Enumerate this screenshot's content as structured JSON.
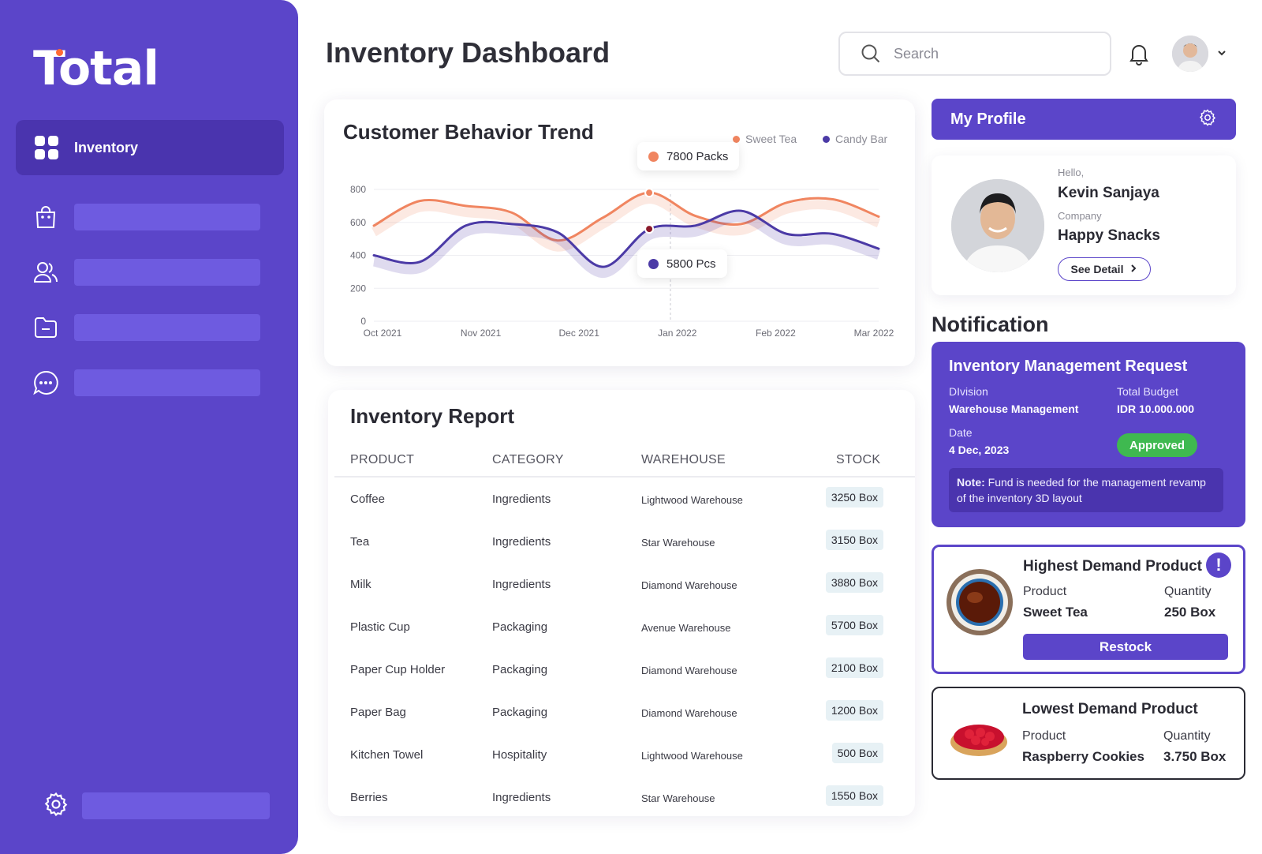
{
  "app": {
    "logo_text": "Total",
    "page_title": "Inventory Dashboard"
  },
  "colors": {
    "accent": "#5b45c9",
    "sweet_tea": "#f08560",
    "candy_bar": "#4b3aa6",
    "approved": "#3fb950"
  },
  "sidebar": {
    "active_item": {
      "label": "Inventory",
      "icon": "grid-icon"
    },
    "items": [
      {
        "icon": "shopping-bag-icon"
      },
      {
        "icon": "users-icon"
      },
      {
        "icon": "folder-icon"
      },
      {
        "icon": "chat-icon"
      }
    ],
    "settings_icon": "gear-icon"
  },
  "header": {
    "search_placeholder": "Search",
    "bell_icon": "bell-icon"
  },
  "chart_data": {
    "type": "line",
    "title": "Customer Behavior Trend",
    "x": [
      "Oct 2021",
      "Nov 2021",
      "Dec 2021",
      "Jan 2022",
      "Feb 2022",
      "Mar 2022"
    ],
    "y_ticks": [
      "800",
      "600",
      "400",
      "200",
      "0"
    ],
    "ylim": [
      0,
      800
    ],
    "grid": true,
    "legend_position": "top-right",
    "series": [
      {
        "name": "Sweet Tea",
        "color": "#f08560",
        "values": [
          580,
          730,
          700,
          660,
          490,
          630,
          780,
          640,
          590,
          720,
          740,
          635
        ]
      },
      {
        "name": "Candy Bar",
        "color": "#4b3aa6",
        "values": [
          400,
          360,
          580,
          590,
          540,
          330,
          560,
          580,
          670,
          530,
          530,
          440
        ]
      }
    ],
    "tooltips": [
      {
        "text": "7800 Packs",
        "series": "Sweet Tea"
      },
      {
        "text": "5800 Pcs",
        "series": "Candy Bar"
      }
    ]
  },
  "report": {
    "title": "Inventory Report",
    "columns": [
      "PRODUCT",
      "CATEGORY",
      "WAREHOUSE",
      "STOCK"
    ],
    "rows": [
      {
        "product": "Coffee",
        "category": "Ingredients",
        "warehouse": "Lightwood Warehouse",
        "stock": "3250 Box"
      },
      {
        "product": "Tea",
        "category": "Ingredients",
        "warehouse": "Star Warehouse",
        "stock": "3150 Box"
      },
      {
        "product": "Milk",
        "category": "Ingredients",
        "warehouse": "Diamond Warehouse",
        "stock": "3880 Box"
      },
      {
        "product": "Plastic Cup",
        "category": "Packaging",
        "warehouse": "Avenue Warehouse",
        "stock": "5700 Box"
      },
      {
        "product": "Paper Cup Holder",
        "category": "Packaging",
        "warehouse": "Diamond Warehouse",
        "stock": "2100 Box"
      },
      {
        "product": "Paper Bag",
        "category": "Packaging",
        "warehouse": "Diamond Warehouse",
        "stock": "1200 Box"
      },
      {
        "product": "Kitchen Towel",
        "category": "Hospitality",
        "warehouse": "Lightwood Warehouse",
        "stock": "500 Box"
      },
      {
        "product": "Berries",
        "category": "Ingredients",
        "warehouse": "Star Warehouse",
        "stock": "1550 Box"
      }
    ]
  },
  "profile": {
    "title": "My Profile",
    "hello_label": "Hello,",
    "name": "Kevin Sanjaya",
    "company_label": "Company",
    "company": "Happy Snacks",
    "see_detail": "See Detail"
  },
  "notification": {
    "title": "Notification",
    "request": {
      "title": "Inventory Management Request",
      "division_label": "DIvision",
      "division": "Warehouse Management",
      "budget_label": "Total Budget",
      "budget": "IDR 10.000.000",
      "date_label": "Date",
      "date": "4 Dec, 2023",
      "status": "Approved",
      "note_label": "Note:",
      "note_text": " Fund is needed for the management revamp of the inventory 3D layout"
    },
    "highest": {
      "title": "Highest Demand Product",
      "product_label": "Product",
      "product": "Sweet Tea",
      "quantity_label": "Quantity",
      "quantity": "250 Box",
      "action": "Restock",
      "alert_glyph": "!"
    },
    "lowest": {
      "title": "Lowest Demand Product",
      "product_label": "Product",
      "product": "Raspberry Cookies",
      "quantity_label": "Quantity",
      "quantity": "3.750 Box"
    }
  }
}
